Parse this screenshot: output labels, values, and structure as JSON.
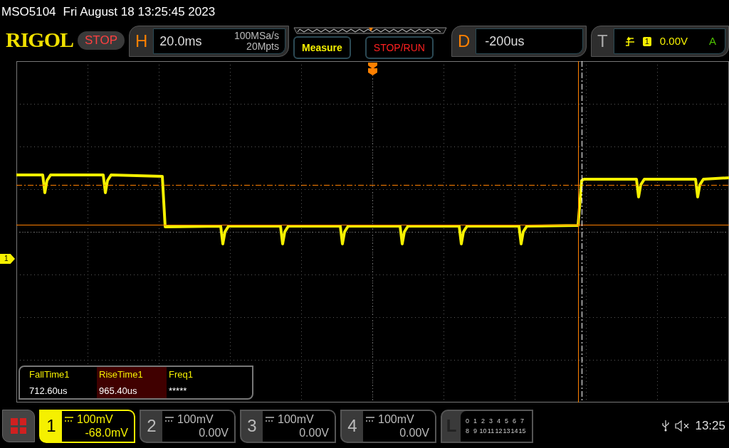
{
  "status_line": {
    "model": "MSO5104",
    "datetime": "Fri August 18 13:25:45 2023"
  },
  "logo": "RIGOL",
  "run_state": "STOP",
  "horizontal": {
    "label": "H",
    "timebase": "20.0ms",
    "sample_rate": "100MSa/s",
    "memory_depth": "20Mpts"
  },
  "buttons": [
    {
      "label": "Measure",
      "kind": "measure"
    },
    {
      "label": "STOP/RUN",
      "kind": "stoprun"
    }
  ],
  "delay": {
    "label": "D",
    "value": "-200us"
  },
  "trigger": {
    "label": "T",
    "source": "1",
    "level": "0.00V",
    "mode": "A"
  },
  "channel_marker": "1",
  "measurements": [
    {
      "name": "FallTime1",
      "value": "712.60us",
      "selected": false
    },
    {
      "name": "RiseTime1",
      "value": "965.40us",
      "selected": true
    },
    {
      "name": "Freq1",
      "value": "*****",
      "selected": false
    }
  ],
  "channels": [
    {
      "number": "1",
      "scale": "100mV",
      "offset": "-68.0mV",
      "selected": true
    },
    {
      "number": "2",
      "scale": "100mV",
      "offset": "0.00V",
      "selected": false
    },
    {
      "number": "3",
      "scale": "100mV",
      "offset": "0.00V",
      "selected": false
    },
    {
      "number": "4",
      "scale": "100mV",
      "offset": "0.00V",
      "selected": false
    }
  ],
  "logic": {
    "label": "L",
    "rows": [
      [
        "0",
        "1",
        "2",
        "3",
        "4",
        "5",
        "6",
        "7"
      ],
      [
        "8",
        "9",
        "10",
        "11",
        "12",
        "13",
        "14",
        "15"
      ]
    ]
  },
  "status_bar": {
    "time": "13:25"
  }
}
